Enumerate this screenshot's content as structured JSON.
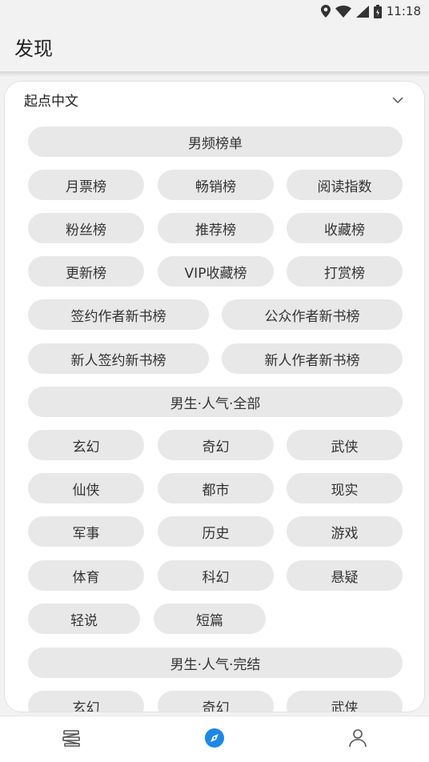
{
  "status_bar": {
    "time": "11:18",
    "icons": [
      "location-icon",
      "wifi-icon",
      "signal-icon",
      "battery-icon"
    ]
  },
  "app_bar": {
    "title": "发现"
  },
  "card": {
    "source": "起点中文",
    "sections": [
      {
        "title": "男频榜单",
        "rows": [
          [
            "月票榜",
            "畅销榜",
            "阅读指数"
          ],
          [
            "粉丝榜",
            "推荐榜",
            "收藏榜"
          ],
          [
            "更新榜",
            "VIP收藏榜",
            "打赏榜"
          ],
          [
            "签约作者新书榜",
            "公众作者新书榜"
          ],
          [
            "新人签约新书榜",
            "新人作者新书榜"
          ]
        ]
      },
      {
        "title": "男生·人气·全部",
        "rows": [
          [
            "玄幻",
            "奇幻",
            "武侠"
          ],
          [
            "仙侠",
            "都市",
            "现实"
          ],
          [
            "军事",
            "历史",
            "游戏"
          ],
          [
            "体育",
            "科幻",
            "悬疑"
          ],
          [
            "轻说",
            "短篇"
          ]
        ]
      },
      {
        "title": "男生·人气·完结",
        "rows": [
          [
            "玄幻",
            "奇幻",
            "武侠"
          ]
        ]
      }
    ]
  },
  "bottom_nav": [
    {
      "icon": "bookshelf-icon",
      "active": false
    },
    {
      "icon": "compass-icon",
      "active": true
    },
    {
      "icon": "profile-icon",
      "active": false
    }
  ],
  "colors": {
    "accent": "#1e88e5",
    "pill_bg": "#e8e8e8",
    "background": "#f2f2f2",
    "icon_gray": "#555555"
  }
}
